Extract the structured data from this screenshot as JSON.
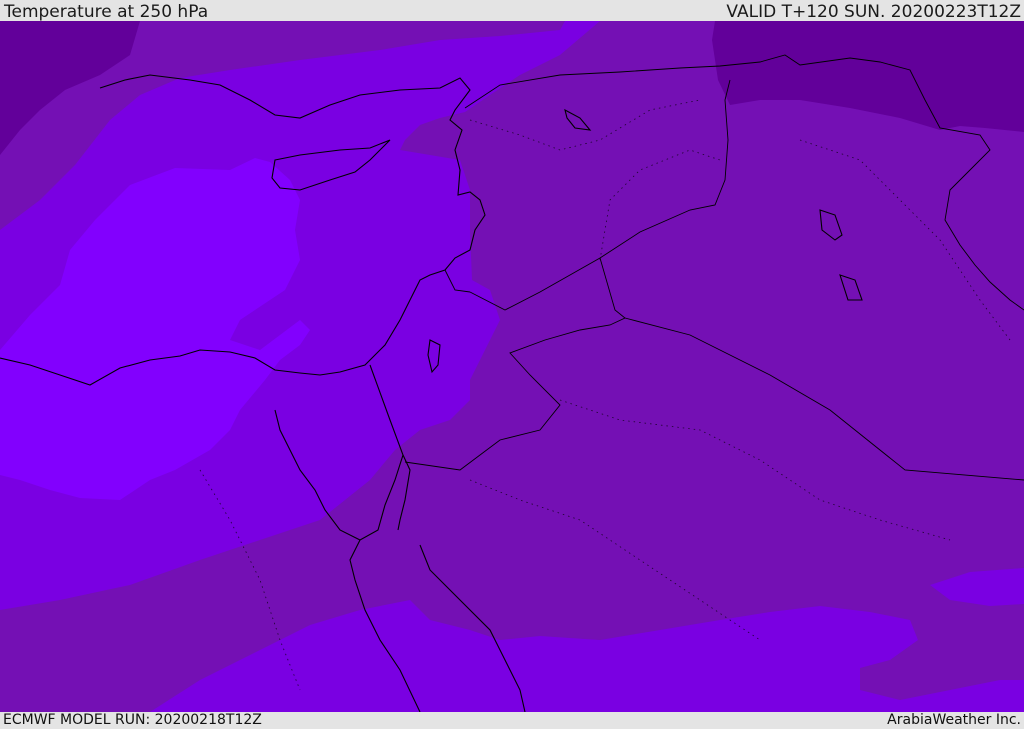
{
  "header": {
    "title": "Temperature at 250 hPa",
    "valid": "VALID T+120 SUN. 20200223T12Z"
  },
  "footer": {
    "model_run": "ECMWF MODEL RUN: 20200218T12Z",
    "credit": "ArabiaWeather Inc."
  },
  "colors": {
    "band_darkest": "#62009a",
    "band_dark": "#7410b4",
    "band_mid": "#7a00e2",
    "band_light": "#8200fe",
    "coastline": "#000000",
    "background": "#e4e4e4"
  }
}
